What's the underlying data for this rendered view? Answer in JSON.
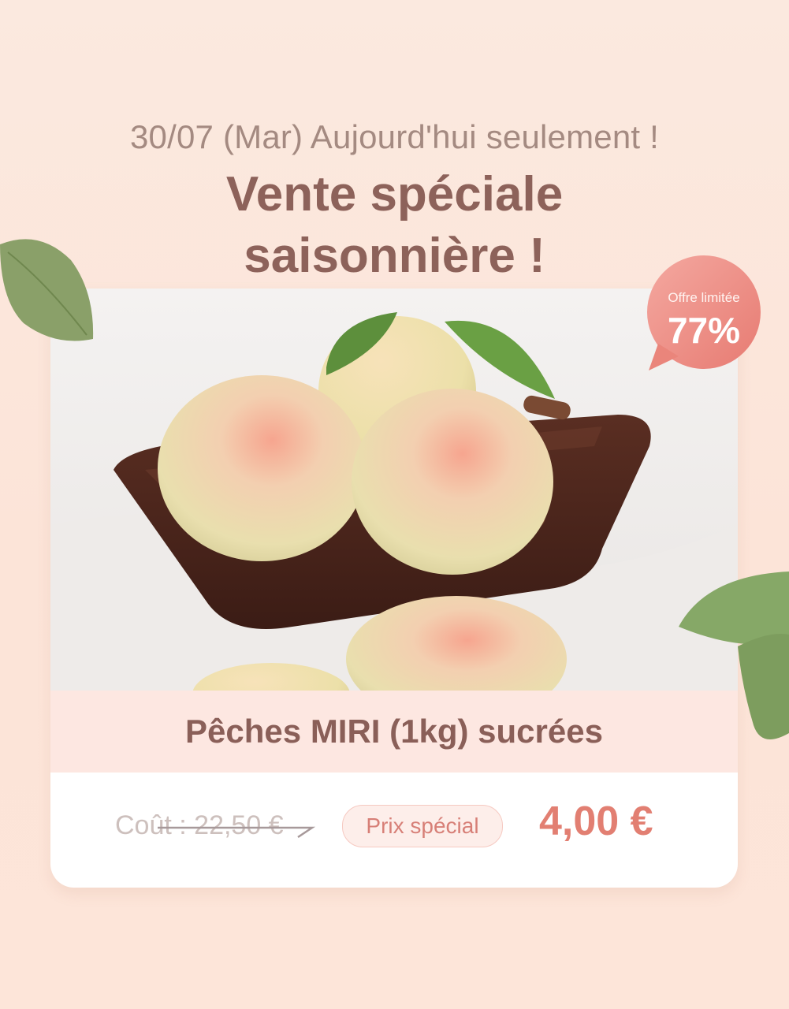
{
  "header": {
    "subtitle": "30/07 (Mar) Aujourd'hui seulement !",
    "title_line1": "Vente spéciale",
    "title_line2": "saisonnière !"
  },
  "badge": {
    "label": "Offre limitée",
    "value": "77%"
  },
  "product": {
    "name": "Pêches MIRI (1kg) sucrées",
    "old_price": "Coût : 22,50 €",
    "special_label": "Prix spécial",
    "new_price": "4,00 €"
  },
  "colors": {
    "background": "#fce6da",
    "title": "#8d625a",
    "accent": "#e27f72",
    "name_bar": "#fde7e1"
  },
  "icons": [
    "leaf-icon",
    "speech-bubble-icon",
    "strike-arrow-icon"
  ]
}
